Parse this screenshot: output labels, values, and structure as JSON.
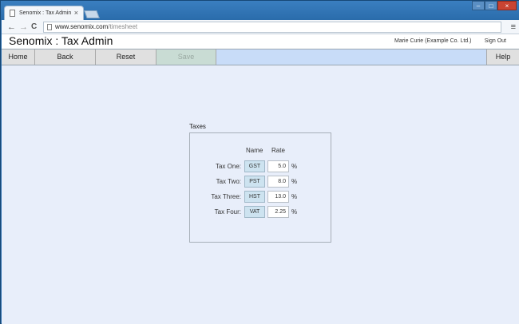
{
  "browser": {
    "tab_title": "Senomix : Tax Admin",
    "tab_close": "×",
    "url_domain": "www.senomix.com",
    "url_path": "/timesheet",
    "back_glyph": "←",
    "forward_glyph": "→",
    "reload_glyph": "C",
    "menu_glyph": "≡",
    "min_glyph": "–",
    "max_glyph": "□",
    "close_glyph": "×"
  },
  "header": {
    "title": "Senomix : Tax Admin",
    "user": "Marie Curie  (Example Co. Ltd.)",
    "sign_out": "Sign Out"
  },
  "nav": {
    "home": "Home",
    "back": "Back",
    "reset": "Reset",
    "save": "Save",
    "help": "Help"
  },
  "taxes": {
    "section_title": "Taxes",
    "col_name": "Name",
    "col_rate": "Rate",
    "pct": "%",
    "rows": [
      {
        "label": "Tax One:",
        "name": "GST",
        "rate": "5.0"
      },
      {
        "label": "Tax Two:",
        "name": "PST",
        "rate": "8.0"
      },
      {
        "label": "Tax Three:",
        "name": "HST",
        "rate": "13.0"
      },
      {
        "label": "Tax Four:",
        "name": "VAT",
        "rate": "2.25"
      }
    ]
  }
}
